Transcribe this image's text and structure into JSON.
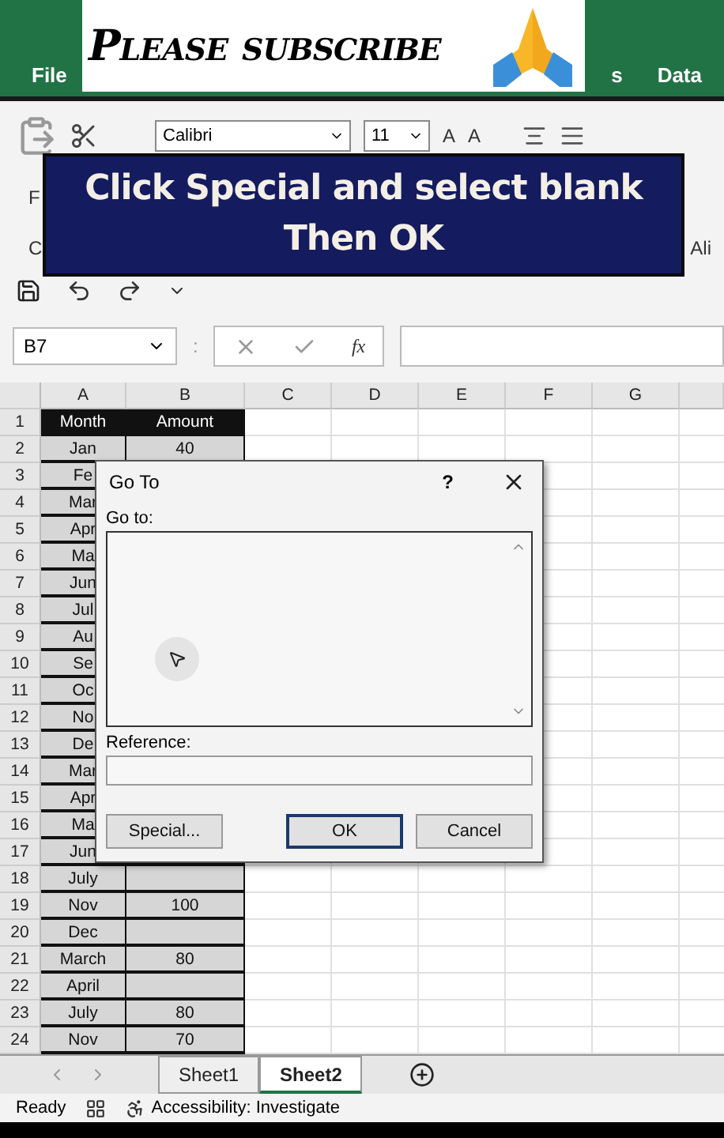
{
  "overlay": {
    "banner": "Please subscribe",
    "caption_lines": [
      "Click Special and select blank",
      "Then OK"
    ]
  },
  "ribbon": {
    "tabs": [
      {
        "label": "File",
        "selected": false
      },
      {
        "label": "s",
        "selected": false
      },
      {
        "label": "Data",
        "selected": false
      }
    ],
    "font": "Calibri",
    "font_size": "11",
    "font_size_buttons": [
      "A",
      "A"
    ],
    "group_labels": [
      "F",
      "C",
      "Ali"
    ]
  },
  "formula_bar": {
    "name_box": "B7",
    "separator": ":",
    "fx": "fx"
  },
  "columns": [
    "A",
    "B",
    "C",
    "D",
    "E",
    "F",
    "G"
  ],
  "rows": [
    {
      "num": "1",
      "a": "Month",
      "b": "Amount",
      "kind": "header"
    },
    {
      "num": "2",
      "a": "Jan",
      "b": "40",
      "kind": "data"
    },
    {
      "num": "3",
      "a": "Fe",
      "kind": "data"
    },
    {
      "num": "4",
      "a": "Mar",
      "kind": "data"
    },
    {
      "num": "5",
      "a": "Apr",
      "kind": "data"
    },
    {
      "num": "6",
      "a": "Ma",
      "kind": "data"
    },
    {
      "num": "7",
      "a": "Jun",
      "kind": "data"
    },
    {
      "num": "8",
      "a": "Jul",
      "kind": "data"
    },
    {
      "num": "9",
      "a": "Au",
      "kind": "data"
    },
    {
      "num": "10",
      "a": "Se",
      "kind": "data"
    },
    {
      "num": "11",
      "a": "Oc",
      "kind": "data"
    },
    {
      "num": "12",
      "a": "No",
      "kind": "data"
    },
    {
      "num": "13",
      "a": "De",
      "kind": "data"
    },
    {
      "num": "14",
      "a": "Mar",
      "kind": "data"
    },
    {
      "num": "15",
      "a": "Apr",
      "kind": "data"
    },
    {
      "num": "16",
      "a": "Ma",
      "kind": "data"
    },
    {
      "num": "17",
      "a": "Jun",
      "kind": "data"
    },
    {
      "num": "18",
      "a": "July",
      "kind": "data"
    },
    {
      "num": "19",
      "a": "Nov",
      "b": "100",
      "kind": "data"
    },
    {
      "num": "20",
      "a": "Dec",
      "kind": "data"
    },
    {
      "num": "21",
      "a": "March",
      "b": "80",
      "kind": "data"
    },
    {
      "num": "22",
      "a": "April",
      "kind": "data"
    },
    {
      "num": "23",
      "a": "July",
      "b": "80",
      "kind": "data"
    },
    {
      "num": "24",
      "a": "Nov",
      "b": "70",
      "kind": "data"
    }
  ],
  "dialog": {
    "title": "Go To",
    "help": "?",
    "goto_label": "Go to:",
    "reference_label": "Reference:",
    "buttons": [
      {
        "label": "Special...",
        "default": false
      },
      {
        "label": "OK",
        "default": true
      },
      {
        "label": "Cancel",
        "default": false
      }
    ]
  },
  "sheets": [
    {
      "label": "Sheet1",
      "selected": false
    },
    {
      "label": "Sheet2",
      "selected": true
    }
  ],
  "status": {
    "ready": "Ready",
    "accessibility": "Accessibility: Investigate"
  }
}
